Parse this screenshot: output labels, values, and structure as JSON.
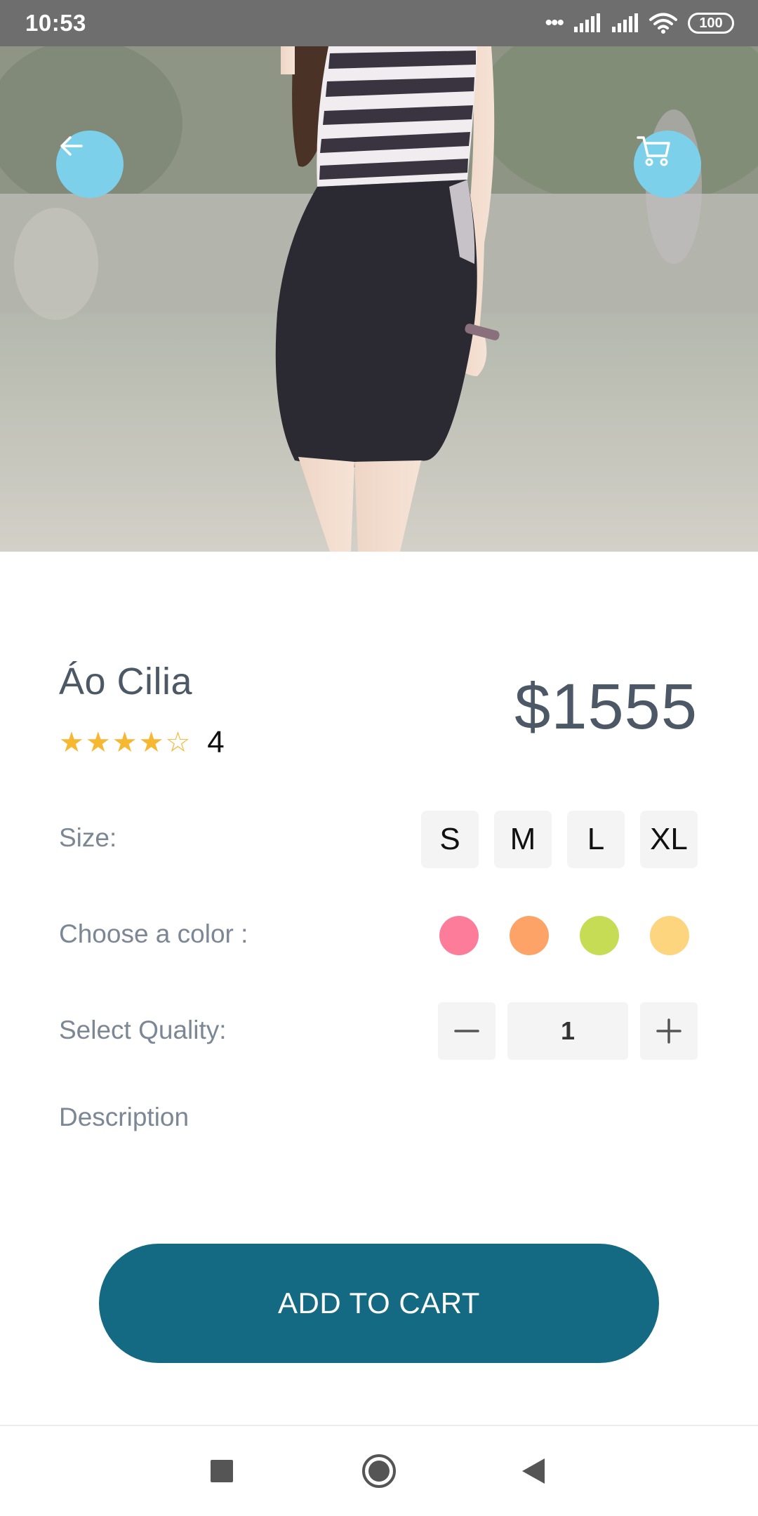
{
  "status_bar": {
    "time": "10:53",
    "battery": "100"
  },
  "hero": {
    "back_icon": "arrow-left-icon",
    "cart_icon": "shopping-cart-icon"
  },
  "product": {
    "name": "Áo Cilia",
    "price": "$1555",
    "rating_value": "4",
    "stars_filled": 4,
    "stars_total": 5
  },
  "options": {
    "size_label": "Size:",
    "sizes": [
      "S",
      "M",
      "L",
      "XL"
    ],
    "color_label": "Choose a color :",
    "colors": [
      "#fd7c9a",
      "#fea368",
      "#c7dc55",
      "#fed57f"
    ],
    "quality_label": "Select Quality:",
    "quantity": "1",
    "description_label": "Description"
  },
  "actions": {
    "add_to_cart": "ADD TO CART"
  },
  "colors": {
    "accent": "#146a82",
    "round_button": "#7dd0ea",
    "text_dark": "#4d5866",
    "text_muted": "#7c8796",
    "star": "#f6b731"
  }
}
